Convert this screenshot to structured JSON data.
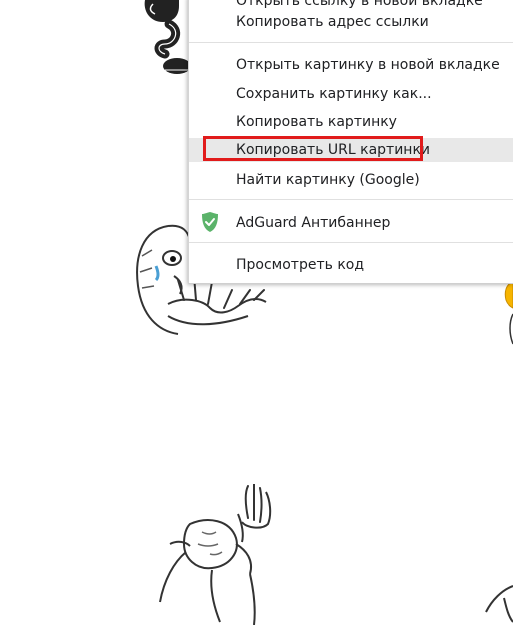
{
  "menu": {
    "partial_item": "Открыть ссылку в новой вкладке",
    "items": [
      "Копировать адрес ссылки",
      "Открыть картинку в новой вкладке",
      "Сохранить картинку как...",
      "Копировать картинку",
      "Копировать URL картинки",
      "Найти картинку (Google)",
      "AdGuard Антибаннер",
      "Просмотреть код"
    ],
    "highlighted_index": 4,
    "highlight_color": "#e11b1b",
    "adguard_icon": "adguard-shield-icon",
    "adguard_color": "#5bb36a"
  }
}
